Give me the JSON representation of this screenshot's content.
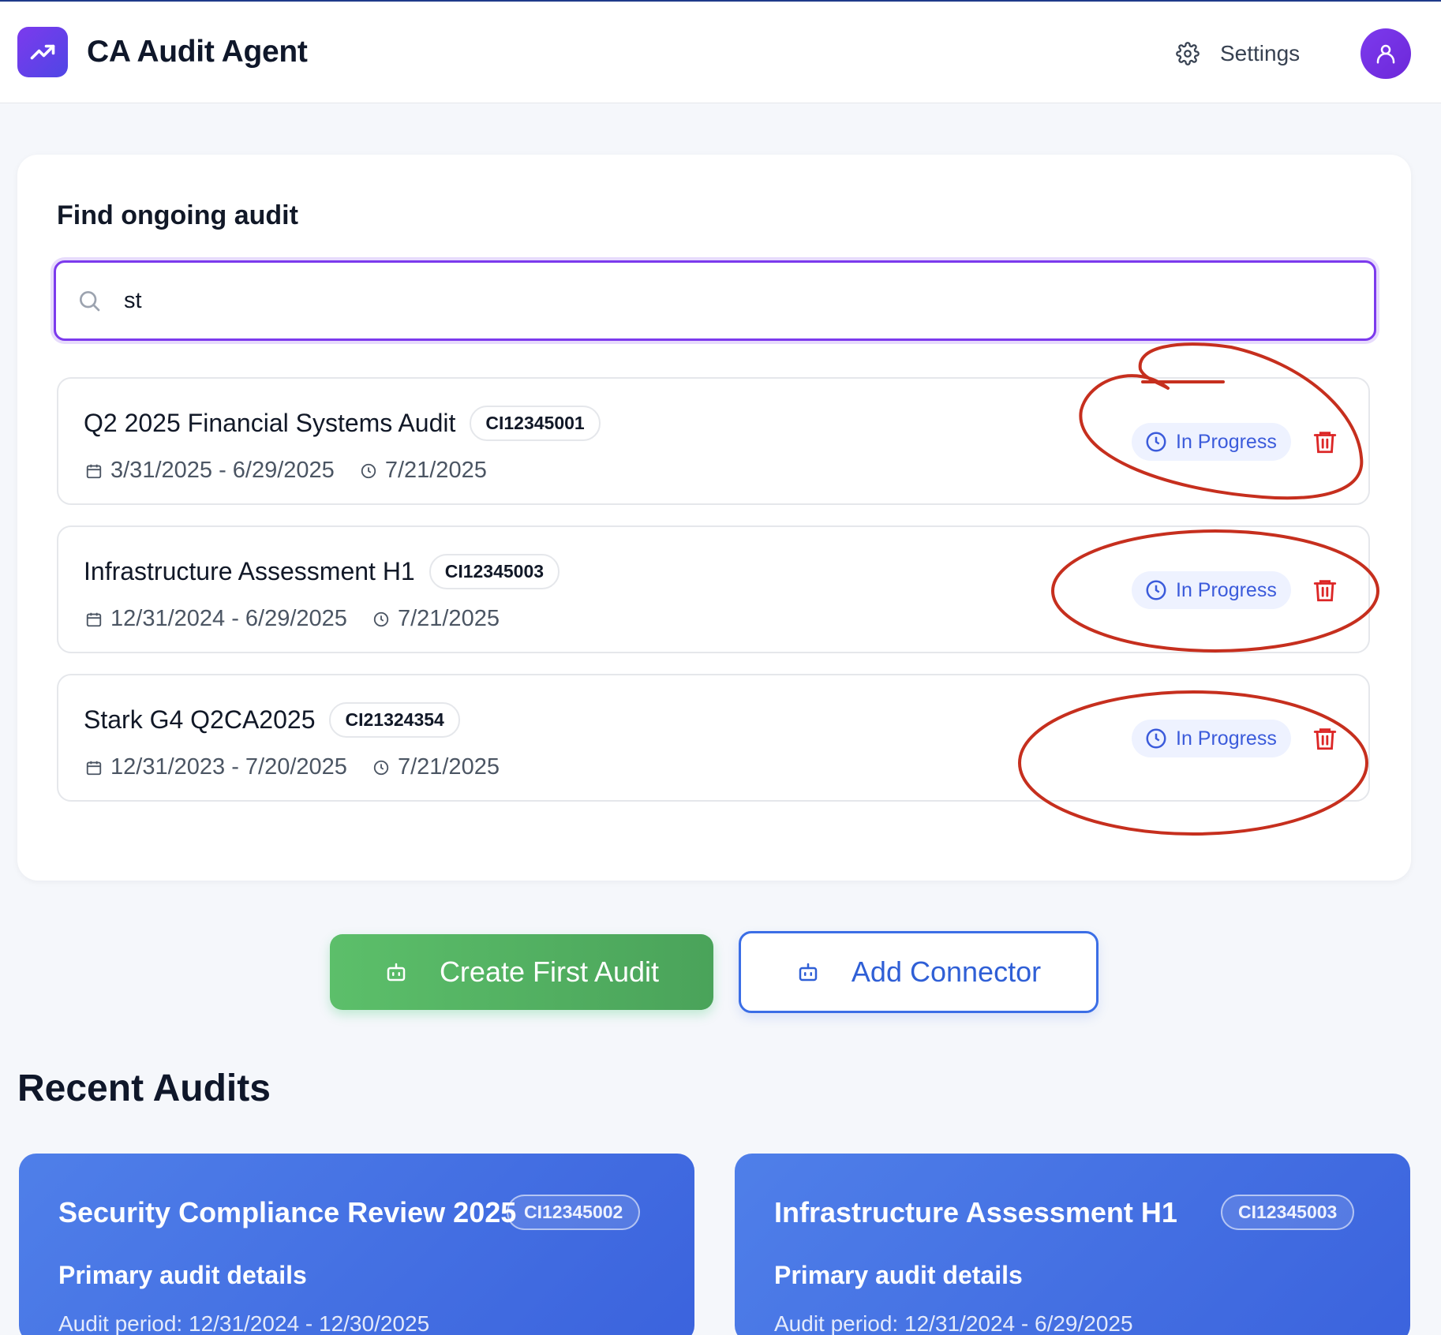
{
  "header": {
    "app_title": "CA Audit Agent",
    "settings_label": "Settings"
  },
  "search": {
    "heading": "Find ongoing audit",
    "value": "st",
    "placeholder": ""
  },
  "results": [
    {
      "title": "Q2 2025 Financial Systems Audit",
      "id": "CI12345001",
      "period": "3/31/2025 - 6/29/2025",
      "updated": "7/21/2025",
      "status": "In Progress"
    },
    {
      "title": "Infrastructure Assessment H1",
      "id": "CI12345003",
      "period": "12/31/2024 - 6/29/2025",
      "updated": "7/21/2025",
      "status": "In Progress"
    },
    {
      "title": "Stark G4 Q2CA2025",
      "id": "CI21324354",
      "period": "12/31/2023 - 7/20/2025",
      "updated": "7/21/2025",
      "status": "In Progress"
    }
  ],
  "actions": {
    "create_label": "Create First Audit",
    "connector_label": "Add Connector"
  },
  "recent": {
    "heading": "Recent Audits",
    "cards": [
      {
        "title": "Security Compliance Review 2025",
        "id": "CI12345002",
        "subtitle": "Primary audit details",
        "period": "Audit period: 12/31/2024 - 12/30/2025"
      },
      {
        "title": "Infrastructure Assessment H1",
        "id": "CI12345003",
        "subtitle": "Primary audit details",
        "period": "Audit period: 12/31/2024 - 6/29/2025"
      }
    ]
  },
  "colors": {
    "brand": "#7c3aed",
    "status_blue": "#3b5bdb",
    "delete_red": "#dc2626",
    "create_green": "#4aa35a",
    "connector_blue": "#3b6ee6",
    "annotation_red": "#c62f1e"
  },
  "icons": {
    "logo": "trending-up-icon",
    "settings": "gear-icon",
    "avatar": "user-icon",
    "search": "search-icon",
    "period": "calendar-icon",
    "updated": "clock-icon",
    "status": "clock-icon",
    "delete": "trash-icon",
    "buttons": "robot-icon"
  }
}
